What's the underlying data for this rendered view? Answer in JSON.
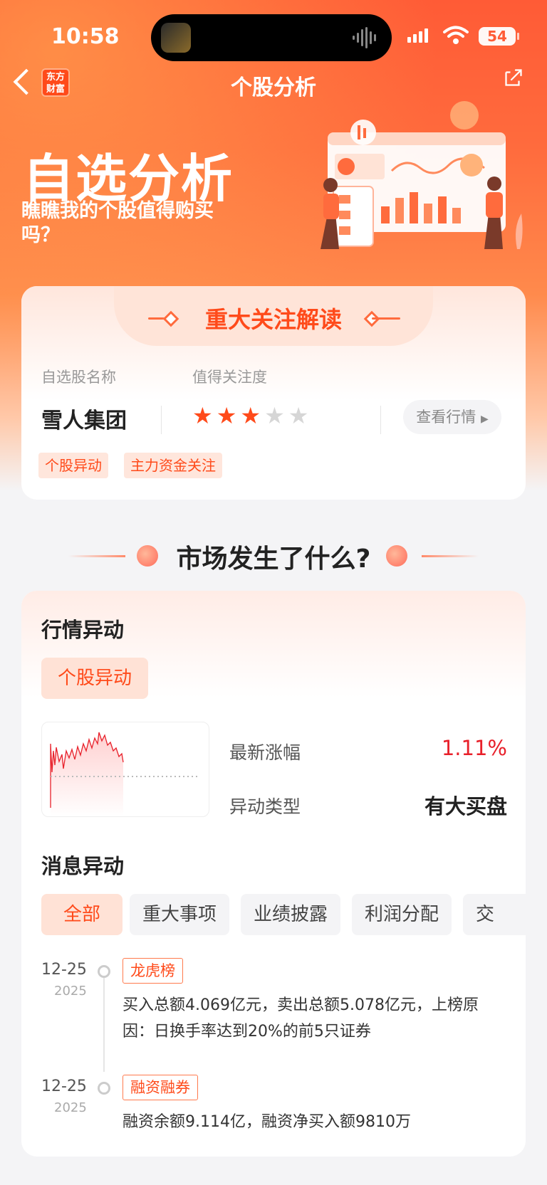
{
  "status_bar": {
    "time": "10:58",
    "battery": "54"
  },
  "nav": {
    "title": "个股分析",
    "logo_line1": "东方",
    "logo_line2": "财富"
  },
  "hero": {
    "title": "自选分析",
    "subtitle": "瞧瞧我的个股值得购买吗？"
  },
  "focus_card": {
    "title": "重大关注解读",
    "stock_name_label": "自选股名称",
    "attention_label": "值得关注度",
    "stock_name": "雪人集团",
    "rating": 3,
    "rating_max": 5,
    "view_button": "查看行情",
    "tags": [
      "个股异动",
      "主力资金关注"
    ]
  },
  "market_section": {
    "title": "市场发生了什么?"
  },
  "quote_anomaly": {
    "title": "行情异动",
    "active_tab": "个股异动",
    "latest_change_label": "最新涨幅",
    "latest_change_value": "1.11%",
    "anomaly_type_label": "异动类型",
    "anomaly_type_value": "有大买盘",
    "colors": {
      "up": "#e8202a",
      "accent": "#ff4a1a"
    }
  },
  "news_anomaly": {
    "title": "消息异动",
    "filters": [
      "全部",
      "重大事项",
      "业绩披露",
      "利润分配",
      "交"
    ],
    "active_filter": "全部",
    "items": [
      {
        "date": "12-25",
        "year": "2025",
        "tag": "龙虎榜",
        "text": "买入总额4.069亿元，卖出总额5.078亿元，上榜原因：日换手率达到20%的前5只证券"
      },
      {
        "date": "12-25",
        "year": "2025",
        "tag": "融资融券",
        "text": "融资余额9.114亿，融资净买入额9810万"
      }
    ]
  }
}
